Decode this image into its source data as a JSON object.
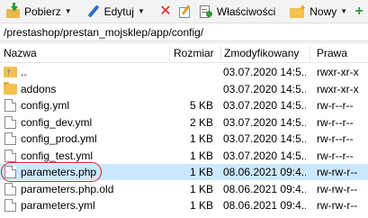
{
  "toolbar": {
    "download": {
      "label": "Pobierz",
      "icon": "download-icon"
    },
    "edit": {
      "label": "Edytuj",
      "icon": "pencil-icon"
    },
    "delete": {
      "icon": "delete-x-icon"
    },
    "rename": {
      "icon": "rename-icon"
    },
    "properties": {
      "label": "Właściwości",
      "icon": "properties-icon"
    },
    "new": {
      "label": "Nowy",
      "icon": "new-folder-icon"
    },
    "add": {
      "icon": "plus-icon"
    }
  },
  "address": {
    "path": "/prestashop/prestan_mojsklep/app/config/"
  },
  "columns": {
    "name": "Nazwa",
    "size": "Rozmiar",
    "modified": "Zmodyfikowany",
    "rights": "Prawa"
  },
  "files": [
    {
      "name": "..",
      "type": "up",
      "size": "",
      "modified": "03.07.2020 14:5...",
      "rights": "rwxr-xr-x"
    },
    {
      "name": "addons",
      "type": "folder",
      "size": "",
      "modified": "03.07.2020 14:5...",
      "rights": "rwxr-xr-x"
    },
    {
      "name": "config.yml",
      "type": "file",
      "size": "5 KB",
      "modified": "03.07.2020 14:5...",
      "rights": "rw-r--r--"
    },
    {
      "name": "config_dev.yml",
      "type": "file",
      "size": "2 KB",
      "modified": "03.07.2020 14:5...",
      "rights": "rw-r--r--"
    },
    {
      "name": "config_prod.yml",
      "type": "file",
      "size": "1 KB",
      "modified": "03.07.2020 14:5...",
      "rights": "rw-r--r--"
    },
    {
      "name": "config_test.yml",
      "type": "file",
      "size": "1 KB",
      "modified": "03.07.2020 14:5...",
      "rights": "rw-r--r--"
    },
    {
      "name": "parameters.php",
      "type": "file",
      "size": "1 KB",
      "modified": "08.06.2021 09:4...",
      "rights": "rw-rw-r--",
      "selected": true
    },
    {
      "name": "parameters.php.old",
      "type": "file",
      "size": "1 KB",
      "modified": "08.06.2021 09:4...",
      "rights": "rw-rw-r--"
    },
    {
      "name": "parameters.yml",
      "type": "file",
      "size": "1 KB",
      "modified": "08.06.2021 09:4...",
      "rights": "rw-rw-r--"
    }
  ],
  "colors": {
    "selection": "#cce8ff",
    "highlight_ring": "#d9202a",
    "folder": "#f2c14e"
  }
}
